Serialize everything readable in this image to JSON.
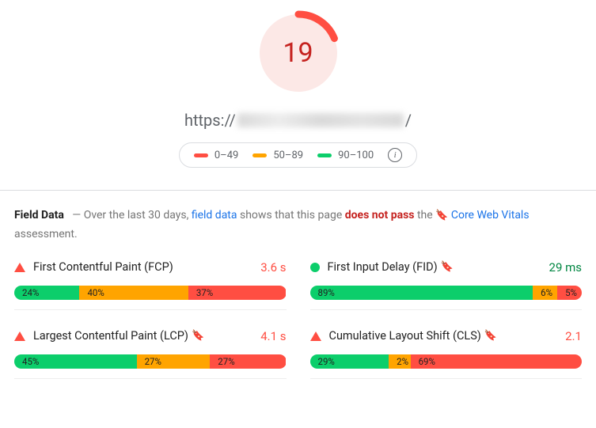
{
  "score": "19",
  "url_prefix": "https://",
  "url_suffix": "/",
  "legend": {
    "r0": "0–49",
    "r1": "50–89",
    "r2": "90–100"
  },
  "field": {
    "label": "Field Data",
    "dash": "—",
    "a": "Over the last 30 days,",
    "link1": "field data",
    "b": "shows that this page",
    "fail": "does not pass",
    "c": "the",
    "link2": "Core Web Vitals",
    "d": "assessment."
  },
  "metrics": {
    "fcp": {
      "name": "First Contentful Paint (FCP)",
      "val": "3.6 s",
      "g": "24%",
      "o": "40%",
      "r": "37%",
      "gw": 24,
      "ow": 40,
      "rw": 36
    },
    "fid": {
      "name": "First Input Delay (FID)",
      "val": "29 ms",
      "g": "89%",
      "o": "6%",
      "r": "5%",
      "gw": 82,
      "ow": 9,
      "rw": 9
    },
    "lcp": {
      "name": "Largest Contentful Paint (LCP)",
      "val": "4.1 s",
      "g": "45%",
      "o": "27%",
      "r": "27%",
      "gw": 45,
      "ow": 27,
      "rw": 28
    },
    "cls": {
      "name": "Cumulative Layout Shift (CLS)",
      "val": "2.1",
      "g": "29%",
      "o": "2%",
      "r": "69%",
      "gw": 29,
      "ow": 8,
      "rw": 63
    }
  }
}
